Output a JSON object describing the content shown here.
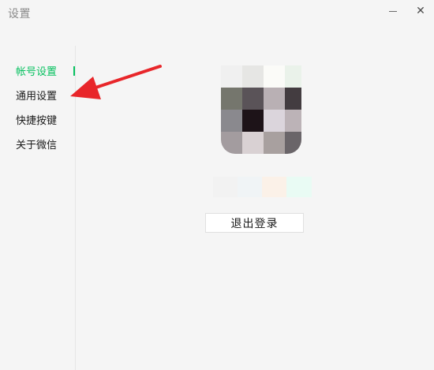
{
  "window": {
    "title": "设置"
  },
  "sidebar": {
    "items": [
      {
        "label": "帐号设置",
        "active": true
      },
      {
        "label": "通用设置",
        "active": false
      },
      {
        "label": "快捷按键",
        "active": false
      },
      {
        "label": "关于微信",
        "active": false
      }
    ]
  },
  "account": {
    "logout_label": "退出登录"
  },
  "colors": {
    "accent": "#07c160",
    "annotation_arrow": "#e8262a"
  },
  "icons": {
    "minimize": "minimize-icon",
    "close": "close-icon",
    "close_glyph": "✕"
  }
}
